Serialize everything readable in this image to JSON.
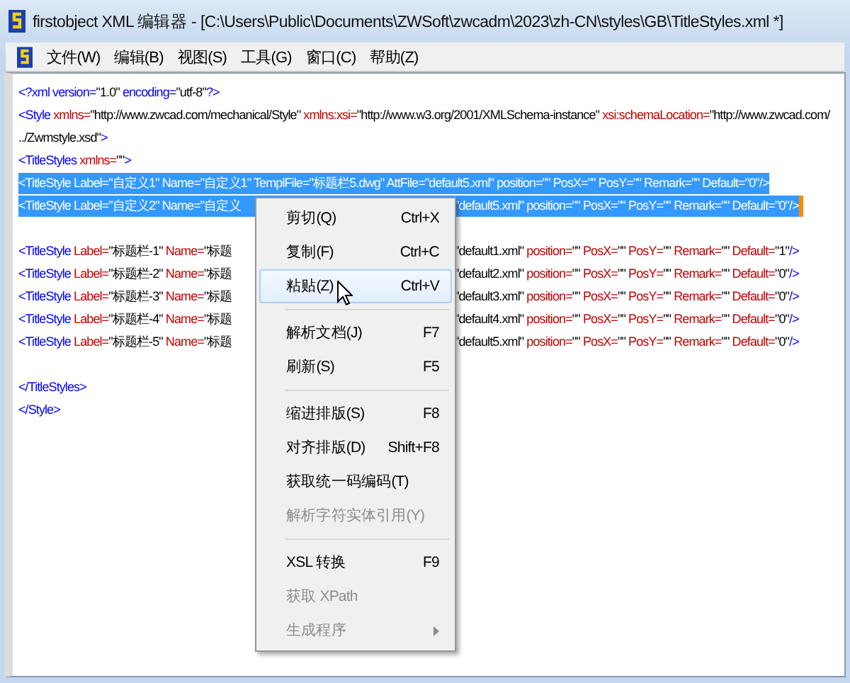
{
  "window": {
    "title": "firstobject XML 编辑器 - [C:\\Users\\Public\\Documents\\ZWSoft\\zwcadm\\2023\\zh-CN\\styles\\GB\\TitleStyles.xml *]"
  },
  "menu_bar": [
    "文件(W)",
    "编辑(B)",
    "视图(S)",
    "工具(G)",
    "窗口(C)",
    "帮助(Z)"
  ],
  "editor": {
    "lines": [
      {
        "selected": false,
        "tokens": [
          {
            "kind": "tag",
            "text": "<?xml version="
          },
          {
            "kind": "value",
            "text": "\"1.0\""
          },
          {
            "kind": "tag",
            "text": " encoding="
          },
          {
            "kind": "value",
            "text": "\"utf-8\""
          },
          {
            "kind": "tag",
            "text": "?>"
          }
        ]
      },
      {
        "selected": false,
        "tokens": [
          {
            "kind": "tag",
            "text": "<Style"
          },
          {
            "kind": "attr",
            "text": " xmlns="
          },
          {
            "kind": "value",
            "text": "\"http://www.zwcad.com/mechanical/Style\""
          },
          {
            "kind": "attr",
            "text": " xmlns:xsi="
          },
          {
            "kind": "value",
            "text": "\"http://www.w3.org/2001/XMLSchema-instance\""
          },
          {
            "kind": "attr",
            "text": " xsi:schemaLocation="
          },
          {
            "kind": "value",
            "text": "\"http://www.zwcad.com/"
          }
        ]
      },
      {
        "selected": false,
        "tokens": [
          {
            "kind": "value",
            "text": "../Zwmstyle.xsd\""
          },
          {
            "kind": "tag",
            "text": ">"
          }
        ]
      },
      {
        "selected": false,
        "tokens": [
          {
            "kind": "tag",
            "text": "<TitleStyles"
          },
          {
            "kind": "attr",
            "text": " xmlns="
          },
          {
            "kind": "value",
            "text": "\"\""
          },
          {
            "kind": "tag",
            "text": ">"
          }
        ]
      },
      {
        "selected": true,
        "tokens": [
          {
            "kind": "tag",
            "text": "<TitleStyle"
          },
          {
            "kind": "attr",
            "text": " Label="
          },
          {
            "kind": "value",
            "text": "\"自定义1\""
          },
          {
            "kind": "attr",
            "text": " Name="
          },
          {
            "kind": "value",
            "text": "\"自定义1\""
          },
          {
            "kind": "attr",
            "text": " TemplFile="
          },
          {
            "kind": "value",
            "text": "\"标题栏5.dwg\""
          },
          {
            "kind": "attr",
            "text": " AttFile="
          },
          {
            "kind": "value",
            "text": "\"default5.xml\""
          },
          {
            "kind": "attr",
            "text": " position="
          },
          {
            "kind": "value",
            "text": "\"\""
          },
          {
            "kind": "attr",
            "text": " PosX="
          },
          {
            "kind": "value",
            "text": "\"\""
          },
          {
            "kind": "attr",
            "text": " PosY="
          },
          {
            "kind": "value",
            "text": "\"\""
          },
          {
            "kind": "attr",
            "text": " Remark="
          },
          {
            "kind": "value",
            "text": "\"\""
          },
          {
            "kind": "attr",
            "text": " Default="
          },
          {
            "kind": "value",
            "text": "\"0\""
          },
          {
            "kind": "tag",
            "text": "/>"
          }
        ]
      },
      {
        "selected": true,
        "caret": true,
        "tokens": [
          {
            "kind": "tag",
            "text": "<TitleStyle"
          },
          {
            "kind": "attr",
            "text": " Label="
          },
          {
            "kind": "value",
            "text": "\"自定义2\""
          },
          {
            "kind": "attr",
            "text": " Name="
          },
          {
            "kind": "value",
            "text": "\"自定义"
          }
        ],
        "after": [
          {
            "kind": "value",
            "text": "\"default5.xml\""
          },
          {
            "kind": "attr",
            "text": " position="
          },
          {
            "kind": "value",
            "text": "\"\""
          },
          {
            "kind": "attr",
            "text": " PosX="
          },
          {
            "kind": "value",
            "text": "\"\""
          },
          {
            "kind": "attr",
            "text": " PosY="
          },
          {
            "kind": "value",
            "text": "\"\""
          },
          {
            "kind": "attr",
            "text": " Remark="
          },
          {
            "kind": "value",
            "text": "\"\""
          },
          {
            "kind": "attr",
            "text": " Default="
          },
          {
            "kind": "value",
            "text": "\"0\""
          },
          {
            "kind": "tag",
            "text": "/>"
          }
        ]
      },
      {
        "selected": false
      },
      {
        "selected": false,
        "tokens": [
          {
            "kind": "tag",
            "text": "<TitleStyle"
          },
          {
            "kind": "attr",
            "text": " Label="
          },
          {
            "kind": "value",
            "text": "\"标题栏-1\""
          },
          {
            "kind": "attr",
            "text": " Name="
          },
          {
            "kind": "value",
            "text": "\"标题"
          }
        ],
        "after": [
          {
            "kind": "value",
            "text": "\"default1.xml\""
          },
          {
            "kind": "attr",
            "text": " position="
          },
          {
            "kind": "value",
            "text": "\"\""
          },
          {
            "kind": "attr",
            "text": " PosX="
          },
          {
            "kind": "value",
            "text": "\"\""
          },
          {
            "kind": "attr",
            "text": " PosY="
          },
          {
            "kind": "value",
            "text": "\"\""
          },
          {
            "kind": "attr",
            "text": " Remark="
          },
          {
            "kind": "value",
            "text": "\"\""
          },
          {
            "kind": "attr",
            "text": " Default="
          },
          {
            "kind": "value",
            "text": "\"1\""
          },
          {
            "kind": "tag",
            "text": "/>"
          }
        ]
      },
      {
        "selected": false,
        "tokens": [
          {
            "kind": "tag",
            "text": "<TitleStyle"
          },
          {
            "kind": "attr",
            "text": " Label="
          },
          {
            "kind": "value",
            "text": "\"标题栏-2\""
          },
          {
            "kind": "attr",
            "text": " Name="
          },
          {
            "kind": "value",
            "text": "\"标题"
          }
        ],
        "after": [
          {
            "kind": "value",
            "text": "\"default2.xml\""
          },
          {
            "kind": "attr",
            "text": " position="
          },
          {
            "kind": "value",
            "text": "\"\""
          },
          {
            "kind": "attr",
            "text": " PosX="
          },
          {
            "kind": "value",
            "text": "\"\""
          },
          {
            "kind": "attr",
            "text": " PosY="
          },
          {
            "kind": "value",
            "text": "\"\""
          },
          {
            "kind": "attr",
            "text": " Remark="
          },
          {
            "kind": "value",
            "text": "\"\""
          },
          {
            "kind": "attr",
            "text": " Default="
          },
          {
            "kind": "value",
            "text": "\"0\""
          },
          {
            "kind": "tag",
            "text": "/>"
          }
        ]
      },
      {
        "selected": false,
        "tokens": [
          {
            "kind": "tag",
            "text": "<TitleStyle"
          },
          {
            "kind": "attr",
            "text": " Label="
          },
          {
            "kind": "value",
            "text": "\"标题栏-3\""
          },
          {
            "kind": "attr",
            "text": " Name="
          },
          {
            "kind": "value",
            "text": "\"标题"
          }
        ],
        "after": [
          {
            "kind": "value",
            "text": "\"default3.xml\""
          },
          {
            "kind": "attr",
            "text": " position="
          },
          {
            "kind": "value",
            "text": "\"\""
          },
          {
            "kind": "attr",
            "text": " PosX="
          },
          {
            "kind": "value",
            "text": "\"\""
          },
          {
            "kind": "attr",
            "text": " PosY="
          },
          {
            "kind": "value",
            "text": "\"\""
          },
          {
            "kind": "attr",
            "text": " Remark="
          },
          {
            "kind": "value",
            "text": "\"\""
          },
          {
            "kind": "attr",
            "text": " Default="
          },
          {
            "kind": "value",
            "text": "\"0\""
          },
          {
            "kind": "tag",
            "text": "/>"
          }
        ]
      },
      {
        "selected": false,
        "tokens": [
          {
            "kind": "tag",
            "text": "<TitleStyle"
          },
          {
            "kind": "attr",
            "text": " Label="
          },
          {
            "kind": "value",
            "text": "\"标题栏-4\""
          },
          {
            "kind": "attr",
            "text": " Name="
          },
          {
            "kind": "value",
            "text": "\"标题"
          }
        ],
        "after": [
          {
            "kind": "value",
            "text": "\"default4.xml\""
          },
          {
            "kind": "attr",
            "text": " position="
          },
          {
            "kind": "value",
            "text": "\"\""
          },
          {
            "kind": "attr",
            "text": " PosX="
          },
          {
            "kind": "value",
            "text": "\"\""
          },
          {
            "kind": "attr",
            "text": " PosY="
          },
          {
            "kind": "value",
            "text": "\"\""
          },
          {
            "kind": "attr",
            "text": " Remark="
          },
          {
            "kind": "value",
            "text": "\"\""
          },
          {
            "kind": "attr",
            "text": " Default="
          },
          {
            "kind": "value",
            "text": "\"0\""
          },
          {
            "kind": "tag",
            "text": "/>"
          }
        ]
      },
      {
        "selected": false,
        "tokens": [
          {
            "kind": "tag",
            "text": "<TitleStyle"
          },
          {
            "kind": "attr",
            "text": " Label="
          },
          {
            "kind": "value",
            "text": "\"标题栏-5\""
          },
          {
            "kind": "attr",
            "text": " Name="
          },
          {
            "kind": "value",
            "text": "\"标题"
          }
        ],
        "after": [
          {
            "kind": "value",
            "text": "\"default5.xml\""
          },
          {
            "kind": "attr",
            "text": " position="
          },
          {
            "kind": "value",
            "text": "\"\""
          },
          {
            "kind": "attr",
            "text": " PosX="
          },
          {
            "kind": "value",
            "text": "\"\""
          },
          {
            "kind": "attr",
            "text": " PosY="
          },
          {
            "kind": "value",
            "text": "\"\""
          },
          {
            "kind": "attr",
            "text": " Remark="
          },
          {
            "kind": "value",
            "text": "\"\""
          },
          {
            "kind": "attr",
            "text": " Default="
          },
          {
            "kind": "value",
            "text": "\"0\""
          },
          {
            "kind": "tag",
            "text": "/>"
          }
        ]
      },
      {
        "selected": false
      },
      {
        "selected": false,
        "tokens": [
          {
            "kind": "tag",
            "text": "</TitleStyles>"
          }
        ]
      },
      {
        "selected": false,
        "tokens": [
          {
            "kind": "tag",
            "text": "</Style>"
          }
        ]
      }
    ]
  },
  "context_menu": [
    {
      "kind": "item",
      "label": "剪切(Q)",
      "shortcut": "Ctrl+X",
      "selected": false,
      "disabled": false
    },
    {
      "kind": "item",
      "label": "复制(F)",
      "shortcut": "Ctrl+C",
      "selected": false,
      "disabled": false
    },
    {
      "kind": "item",
      "label": "粘贴(Z)",
      "shortcut": "Ctrl+V",
      "selected": true,
      "disabled": false
    },
    {
      "kind": "separator"
    },
    {
      "kind": "item",
      "label": "解析文档(J)",
      "shortcut": "F7",
      "selected": false,
      "disabled": false
    },
    {
      "kind": "item",
      "label": "刷新(S)",
      "shortcut": "F5",
      "selected": false,
      "disabled": false
    },
    {
      "kind": "separator"
    },
    {
      "kind": "item",
      "label": "缩进排版(S)",
      "shortcut": "F8",
      "selected": false,
      "disabled": false
    },
    {
      "kind": "item",
      "label": "对齐排版(D)",
      "shortcut": "Shift+F8",
      "selected": false,
      "disabled": false
    },
    {
      "kind": "item",
      "label": "获取统一码编码(T)",
      "selected": false,
      "disabled": false
    },
    {
      "kind": "item",
      "label": "解析字符实体引用(Y)",
      "selected": false,
      "disabled": true
    },
    {
      "kind": "separator"
    },
    {
      "kind": "item",
      "label": "XSL 转换",
      "shortcut": "F9",
      "selected": false,
      "disabled": false
    },
    {
      "kind": "item",
      "label": "获取 XPath",
      "selected": false,
      "disabled": true
    },
    {
      "kind": "item",
      "label": "生成程序",
      "selected": false,
      "disabled": true,
      "submenu": true
    }
  ]
}
